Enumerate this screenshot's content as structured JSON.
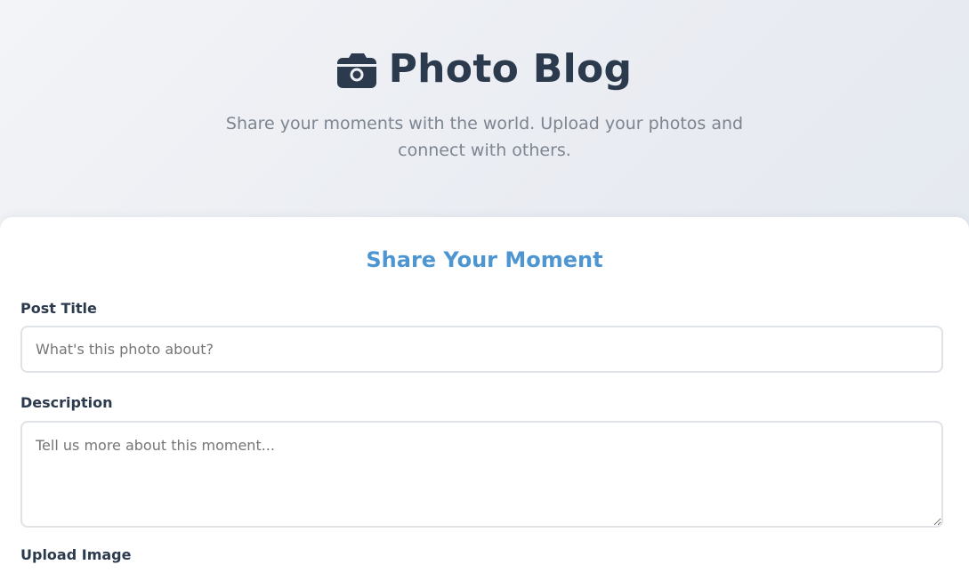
{
  "header": {
    "icon": "camera-icon",
    "title": "Photo Blog",
    "tagline": "Share your moments with the world. Upload your photos and connect with others."
  },
  "form": {
    "heading": "Share Your Moment",
    "title_field": {
      "label": "Post Title",
      "placeholder": "What's this photo about?",
      "value": ""
    },
    "description_field": {
      "label": "Description",
      "placeholder": "Tell us more about this moment...",
      "value": ""
    },
    "upload_field": {
      "label": "Upload Image"
    }
  },
  "colors": {
    "primary_text": "#2c3a4d",
    "accent": "#4e96d1",
    "muted_text": "#7d8590",
    "border": "#dfe2e6"
  }
}
